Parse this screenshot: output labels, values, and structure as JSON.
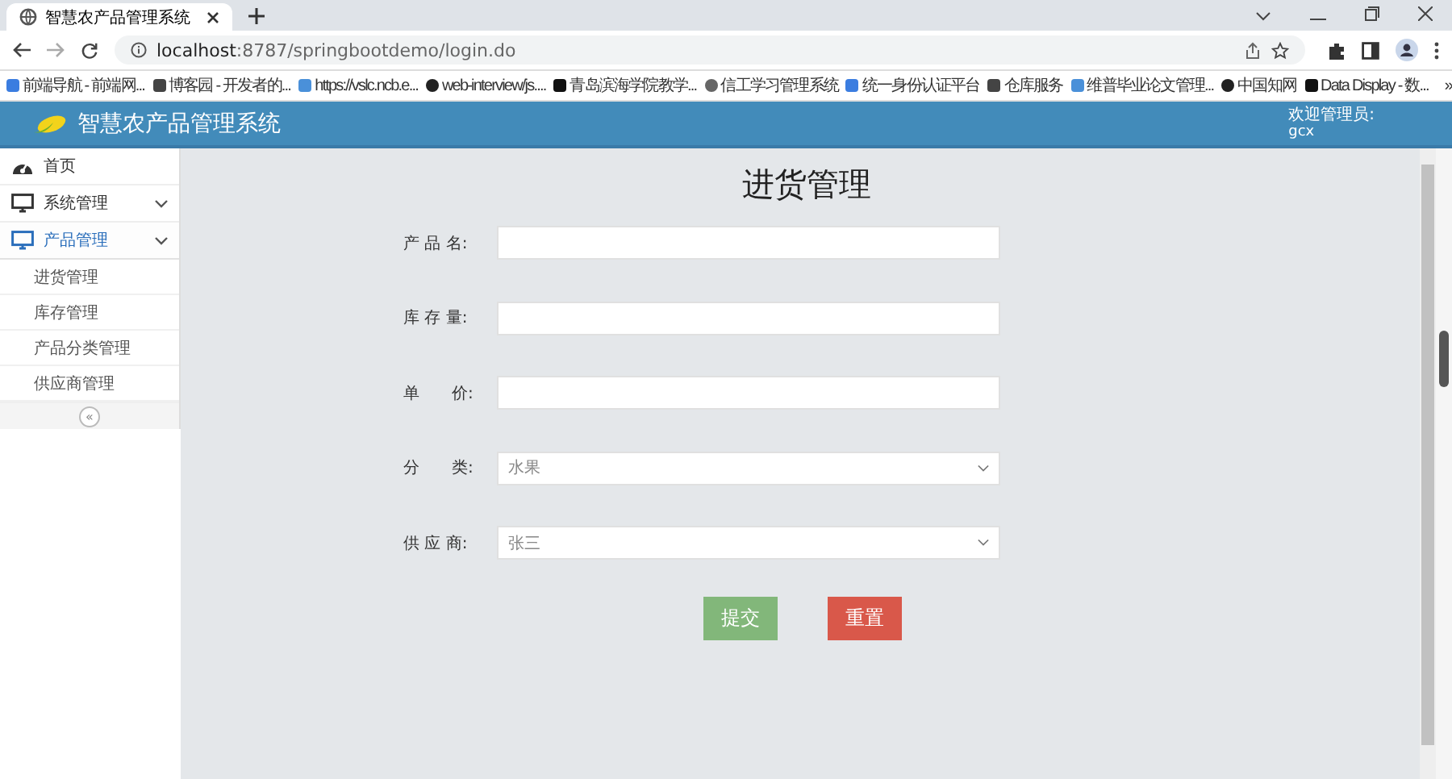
{
  "browser": {
    "tabs": [
      {
        "title": "智慧农产品管理系统",
        "selected": true
      }
    ],
    "address_host": "localhost",
    "address_path": ":8787/springbootdemo/login.do",
    "bookmarks": [
      {
        "label": "前端导航 - 前端网..."
      },
      {
        "label": "博客园 - 开发者的..."
      },
      {
        "label": "https://vslc.ncb.e..."
      },
      {
        "label": "web-interview/js...."
      },
      {
        "label": "青岛滨海学院教学..."
      },
      {
        "label": "信工学习管理系统"
      },
      {
        "label": "统一身份认证平台"
      },
      {
        "label": "仓库服务"
      },
      {
        "label": "维普毕业论文管理..."
      },
      {
        "label": "中国知网"
      },
      {
        "label": "Data Display - 数..."
      }
    ],
    "bookmarks_more": "»"
  },
  "header": {
    "title": "智慧农产品管理系统",
    "welcome": "欢迎管理员:",
    "user": "gcx"
  },
  "sidebar": {
    "items": [
      {
        "label": "首页",
        "kind": "link",
        "selected": false
      },
      {
        "label": "系统管理",
        "kind": "group",
        "expanded": false,
        "selected": false
      },
      {
        "label": "产品管理",
        "kind": "group",
        "expanded": true,
        "selected": true,
        "children": [
          {
            "label": "进货管理",
            "selected": false
          },
          {
            "label": "库存管理",
            "selected": false
          },
          {
            "label": "产品分类管理",
            "selected": false
          },
          {
            "label": "供应商管理",
            "selected": false
          }
        ]
      }
    ],
    "collapse": "«"
  },
  "page": {
    "title": "进货管理",
    "fields": [
      {
        "label": "产 品 名:",
        "kind": "text"
      },
      {
        "label": "库 存 量:",
        "kind": "text"
      },
      {
        "label": "单　　价:",
        "kind": "text"
      },
      {
        "label": "分　　类:",
        "kind": "select",
        "value": "水果"
      },
      {
        "label": "供 应 商:",
        "kind": "select",
        "value": "张三"
      }
    ],
    "buttons": [
      {
        "label": "提交",
        "kind": "submit"
      },
      {
        "label": "重置",
        "kind": "reset"
      }
    ]
  }
}
